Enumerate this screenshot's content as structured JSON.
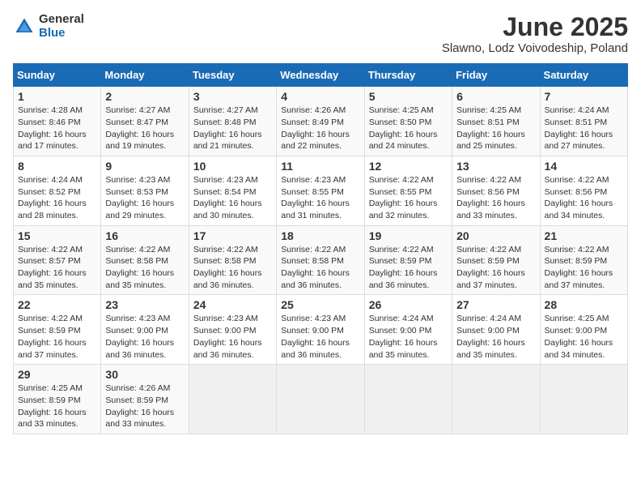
{
  "logo": {
    "general": "General",
    "blue": "Blue"
  },
  "title": {
    "month": "June 2025",
    "location": "Slawno, Lodz Voivodeship, Poland"
  },
  "headers": [
    "Sunday",
    "Monday",
    "Tuesday",
    "Wednesday",
    "Thursday",
    "Friday",
    "Saturday"
  ],
  "weeks": [
    [
      {
        "day": "1",
        "info": "Sunrise: 4:28 AM\nSunset: 8:46 PM\nDaylight: 16 hours\nand 17 minutes."
      },
      {
        "day": "2",
        "info": "Sunrise: 4:27 AM\nSunset: 8:47 PM\nDaylight: 16 hours\nand 19 minutes."
      },
      {
        "day": "3",
        "info": "Sunrise: 4:27 AM\nSunset: 8:48 PM\nDaylight: 16 hours\nand 21 minutes."
      },
      {
        "day": "4",
        "info": "Sunrise: 4:26 AM\nSunset: 8:49 PM\nDaylight: 16 hours\nand 22 minutes."
      },
      {
        "day": "5",
        "info": "Sunrise: 4:25 AM\nSunset: 8:50 PM\nDaylight: 16 hours\nand 24 minutes."
      },
      {
        "day": "6",
        "info": "Sunrise: 4:25 AM\nSunset: 8:51 PM\nDaylight: 16 hours\nand 25 minutes."
      },
      {
        "day": "7",
        "info": "Sunrise: 4:24 AM\nSunset: 8:51 PM\nDaylight: 16 hours\nand 27 minutes."
      }
    ],
    [
      {
        "day": "8",
        "info": "Sunrise: 4:24 AM\nSunset: 8:52 PM\nDaylight: 16 hours\nand 28 minutes."
      },
      {
        "day": "9",
        "info": "Sunrise: 4:23 AM\nSunset: 8:53 PM\nDaylight: 16 hours\nand 29 minutes."
      },
      {
        "day": "10",
        "info": "Sunrise: 4:23 AM\nSunset: 8:54 PM\nDaylight: 16 hours\nand 30 minutes."
      },
      {
        "day": "11",
        "info": "Sunrise: 4:23 AM\nSunset: 8:55 PM\nDaylight: 16 hours\nand 31 minutes."
      },
      {
        "day": "12",
        "info": "Sunrise: 4:22 AM\nSunset: 8:55 PM\nDaylight: 16 hours\nand 32 minutes."
      },
      {
        "day": "13",
        "info": "Sunrise: 4:22 AM\nSunset: 8:56 PM\nDaylight: 16 hours\nand 33 minutes."
      },
      {
        "day": "14",
        "info": "Sunrise: 4:22 AM\nSunset: 8:56 PM\nDaylight: 16 hours\nand 34 minutes."
      }
    ],
    [
      {
        "day": "15",
        "info": "Sunrise: 4:22 AM\nSunset: 8:57 PM\nDaylight: 16 hours\nand 35 minutes."
      },
      {
        "day": "16",
        "info": "Sunrise: 4:22 AM\nSunset: 8:58 PM\nDaylight: 16 hours\nand 35 minutes."
      },
      {
        "day": "17",
        "info": "Sunrise: 4:22 AM\nSunset: 8:58 PM\nDaylight: 16 hours\nand 36 minutes."
      },
      {
        "day": "18",
        "info": "Sunrise: 4:22 AM\nSunset: 8:58 PM\nDaylight: 16 hours\nand 36 minutes."
      },
      {
        "day": "19",
        "info": "Sunrise: 4:22 AM\nSunset: 8:59 PM\nDaylight: 16 hours\nand 36 minutes."
      },
      {
        "day": "20",
        "info": "Sunrise: 4:22 AM\nSunset: 8:59 PM\nDaylight: 16 hours\nand 37 minutes."
      },
      {
        "day": "21",
        "info": "Sunrise: 4:22 AM\nSunset: 8:59 PM\nDaylight: 16 hours\nand 37 minutes."
      }
    ],
    [
      {
        "day": "22",
        "info": "Sunrise: 4:22 AM\nSunset: 8:59 PM\nDaylight: 16 hours\nand 37 minutes."
      },
      {
        "day": "23",
        "info": "Sunrise: 4:23 AM\nSunset: 9:00 PM\nDaylight: 16 hours\nand 36 minutes."
      },
      {
        "day": "24",
        "info": "Sunrise: 4:23 AM\nSunset: 9:00 PM\nDaylight: 16 hours\nand 36 minutes."
      },
      {
        "day": "25",
        "info": "Sunrise: 4:23 AM\nSunset: 9:00 PM\nDaylight: 16 hours\nand 36 minutes."
      },
      {
        "day": "26",
        "info": "Sunrise: 4:24 AM\nSunset: 9:00 PM\nDaylight: 16 hours\nand 35 minutes."
      },
      {
        "day": "27",
        "info": "Sunrise: 4:24 AM\nSunset: 9:00 PM\nDaylight: 16 hours\nand 35 minutes."
      },
      {
        "day": "28",
        "info": "Sunrise: 4:25 AM\nSunset: 9:00 PM\nDaylight: 16 hours\nand 34 minutes."
      }
    ],
    [
      {
        "day": "29",
        "info": "Sunrise: 4:25 AM\nSunset: 8:59 PM\nDaylight: 16 hours\nand 33 minutes."
      },
      {
        "day": "30",
        "info": "Sunrise: 4:26 AM\nSunset: 8:59 PM\nDaylight: 16 hours\nand 33 minutes."
      },
      null,
      null,
      null,
      null,
      null
    ]
  ]
}
